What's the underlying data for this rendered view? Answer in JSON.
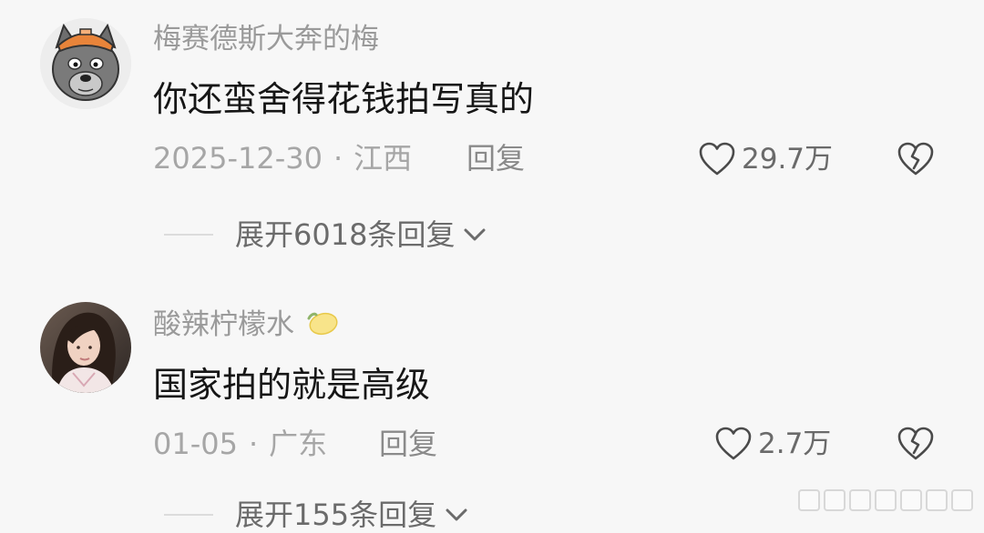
{
  "comments": [
    {
      "username": "梅赛德斯大奔的梅",
      "text": "你还蛮舍得花钱拍写真的",
      "date": "2025-12-30",
      "separator": "·",
      "location": "江西",
      "reply_label": "回复",
      "likes": "29.7万",
      "expand_label": "展开6018条回复",
      "avatar_icon": "grey-wolf-cartoon-avatar",
      "like_icon": "heart-outline-icon",
      "dislike_icon": "broken-heart-icon"
    },
    {
      "username": "酸辣柠檬水",
      "username_emoji": "🍋",
      "text": "国家拍的就是高级",
      "date": "01-05",
      "separator": "·",
      "location": "广东",
      "reply_label": "回复",
      "likes": "2.7万",
      "expand_label": "展开155条回复",
      "avatar_icon": "photo-avatar",
      "like_icon": "heart-outline-icon",
      "dislike_icon": "broken-heart-icon"
    }
  ],
  "colors": {
    "background": "#f7f7f7",
    "username": "#9a9a9a",
    "content": "#161616",
    "meta": "#a6a6a6",
    "icon": "#4a4a4a"
  }
}
